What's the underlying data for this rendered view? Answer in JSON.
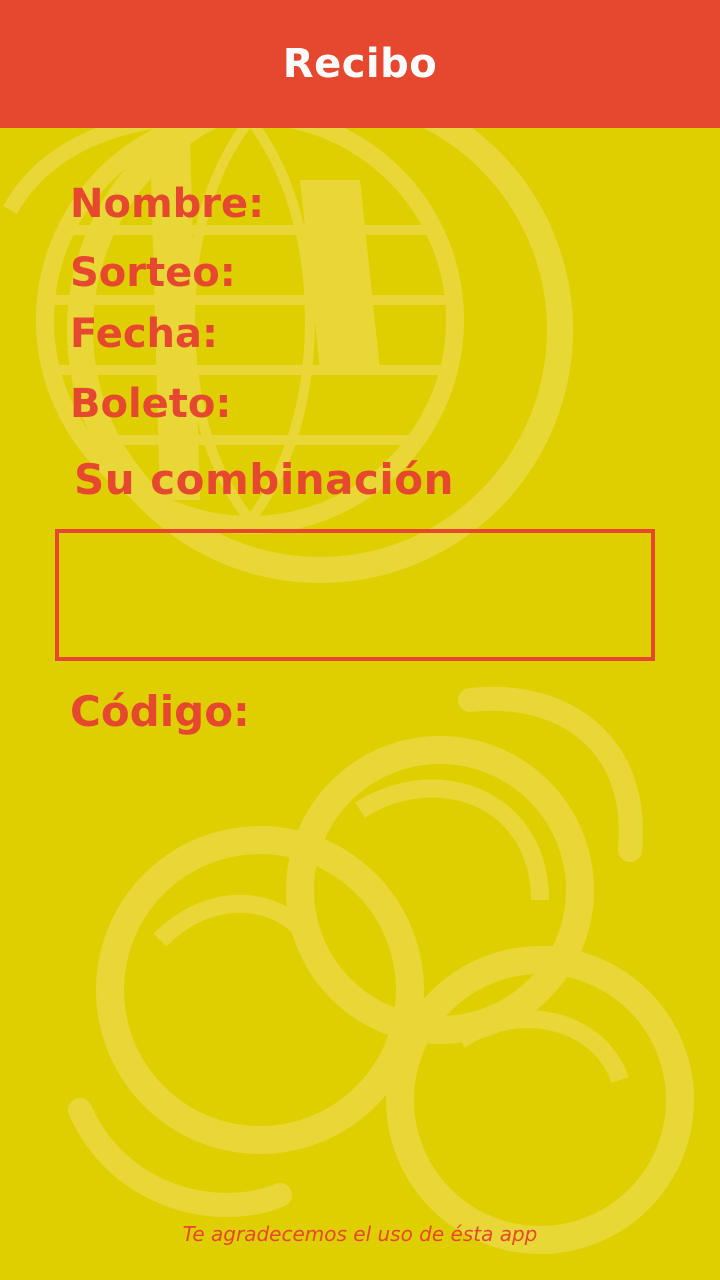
{
  "header": {
    "title": "Recibo"
  },
  "receipt": {
    "nombre_label": "Nombre:",
    "sorteo_label": "Sorteo:",
    "fecha_label": "Fecha:",
    "boleto_label": "Boleto:",
    "combinacion_label": "Su combinación",
    "combinacion_value": "",
    "codigo_label": "Código:"
  },
  "footer": {
    "text": "Te agradecemos el uso de ésta app"
  },
  "colors": {
    "header_bg": "#e5482e",
    "page_bg": "#e0cf00",
    "accent": "#e5482e",
    "watermark": "#ead63a"
  },
  "icons": {
    "watermark_top": "globe-logo-icon",
    "watermark_bottom": "lottery-balls-icon"
  }
}
